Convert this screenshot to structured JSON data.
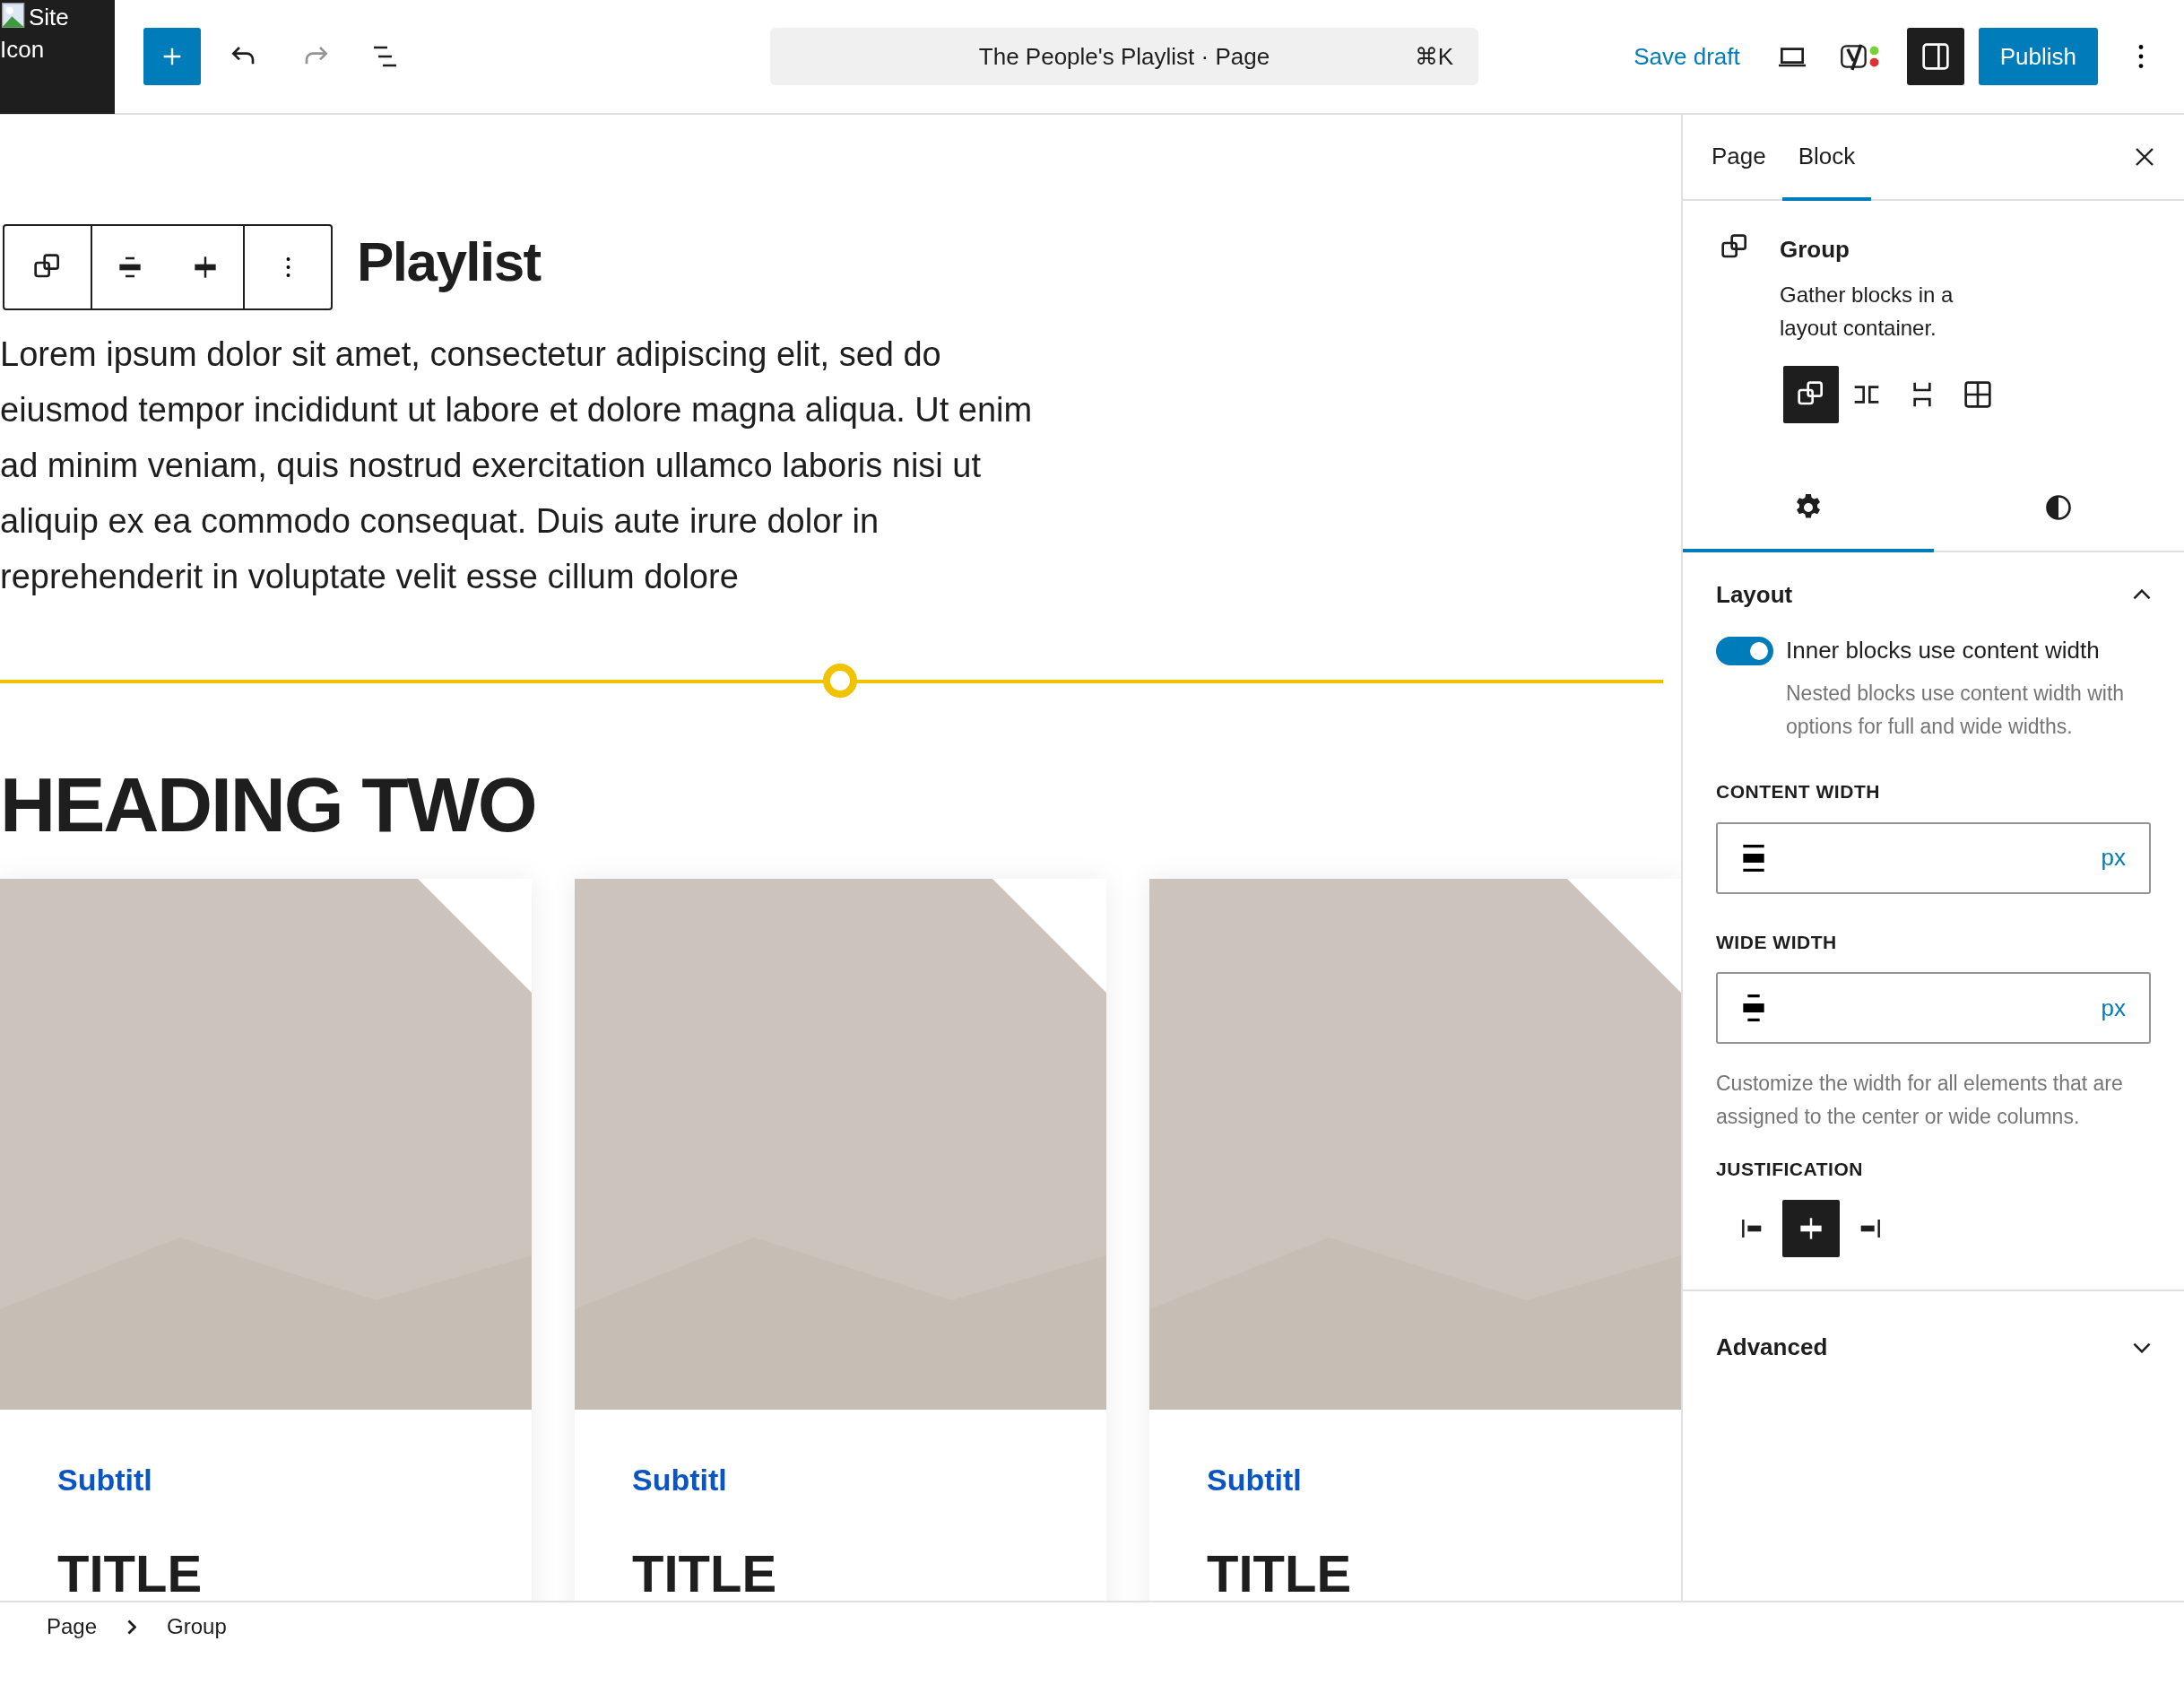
{
  "site_icon": {
    "alt_text": "Site Icon"
  },
  "header_tools": [
    {
      "kind": "inserter",
      "disabled": false
    },
    {
      "kind": "undo",
      "disabled": false
    },
    {
      "kind": "redo",
      "disabled": true
    },
    {
      "kind": "list_view",
      "disabled": false
    }
  ],
  "command_bar": {
    "title": "The People's Playlist · Page",
    "shortcut": "⌘K"
  },
  "header_actions": {
    "save_draft": "Save draft",
    "publish": "Publish",
    "settings_open": true
  },
  "canvas": {
    "heading": "Playlist",
    "paragraph": "Lorem ipsum dolor sit amet, consectetur adipiscing elit, sed do eiusmod tempor incididunt ut labore et dolore magna aliqua. Ut enim ad minim veniam, quis nostrud exercitation ullamco laboris nisi ut aliquip ex ea commodo consequat. Duis aute irure dolor in reprehenderit in voluptate velit esse cillum dolore",
    "heading_two": "HEADING TWO",
    "cards": [
      {
        "subtitle": "Subtitl",
        "title": "TITLE"
      },
      {
        "subtitle": "Subtitl",
        "title": "TITLE"
      },
      {
        "subtitle": "Subtitl",
        "title": "TITLE"
      }
    ]
  },
  "sidebar": {
    "tabs": [
      {
        "label": "Page",
        "selected": false
      },
      {
        "label": "Block",
        "selected": true
      }
    ],
    "block": {
      "name": "Group",
      "description": "Gather blocks in a layout container."
    },
    "variations": [
      {
        "kind": "group",
        "selected": true
      },
      {
        "kind": "row",
        "selected": false
      },
      {
        "kind": "stack",
        "selected": false
      },
      {
        "kind": "grid",
        "selected": false
      }
    ],
    "settings_tabs": [
      {
        "kind": "settings",
        "selected": true
      },
      {
        "kind": "styles",
        "selected": false
      }
    ],
    "layout_panel": {
      "title": "Layout",
      "expanded": true,
      "toggle": {
        "label": "Inner blocks use content width",
        "on": true,
        "help": "Nested blocks use content width with options for full and wide widths."
      },
      "content_width": {
        "label": "CONTENT WIDTH",
        "unit": "px"
      },
      "wide_width": {
        "label": "WIDE WIDTH",
        "unit": "px"
      },
      "help": "Customize the width for all elements that are assigned to the center or wide columns.",
      "justification": {
        "label": "JUSTIFICATION",
        "options": [
          {
            "kind": "left",
            "selected": false
          },
          {
            "kind": "center",
            "selected": true
          },
          {
            "kind": "right",
            "selected": false
          }
        ]
      }
    },
    "advanced_panel": {
      "title": "Advanced",
      "expanded": false
    }
  },
  "breadcrumbs": [
    "Page",
    "Group"
  ]
}
